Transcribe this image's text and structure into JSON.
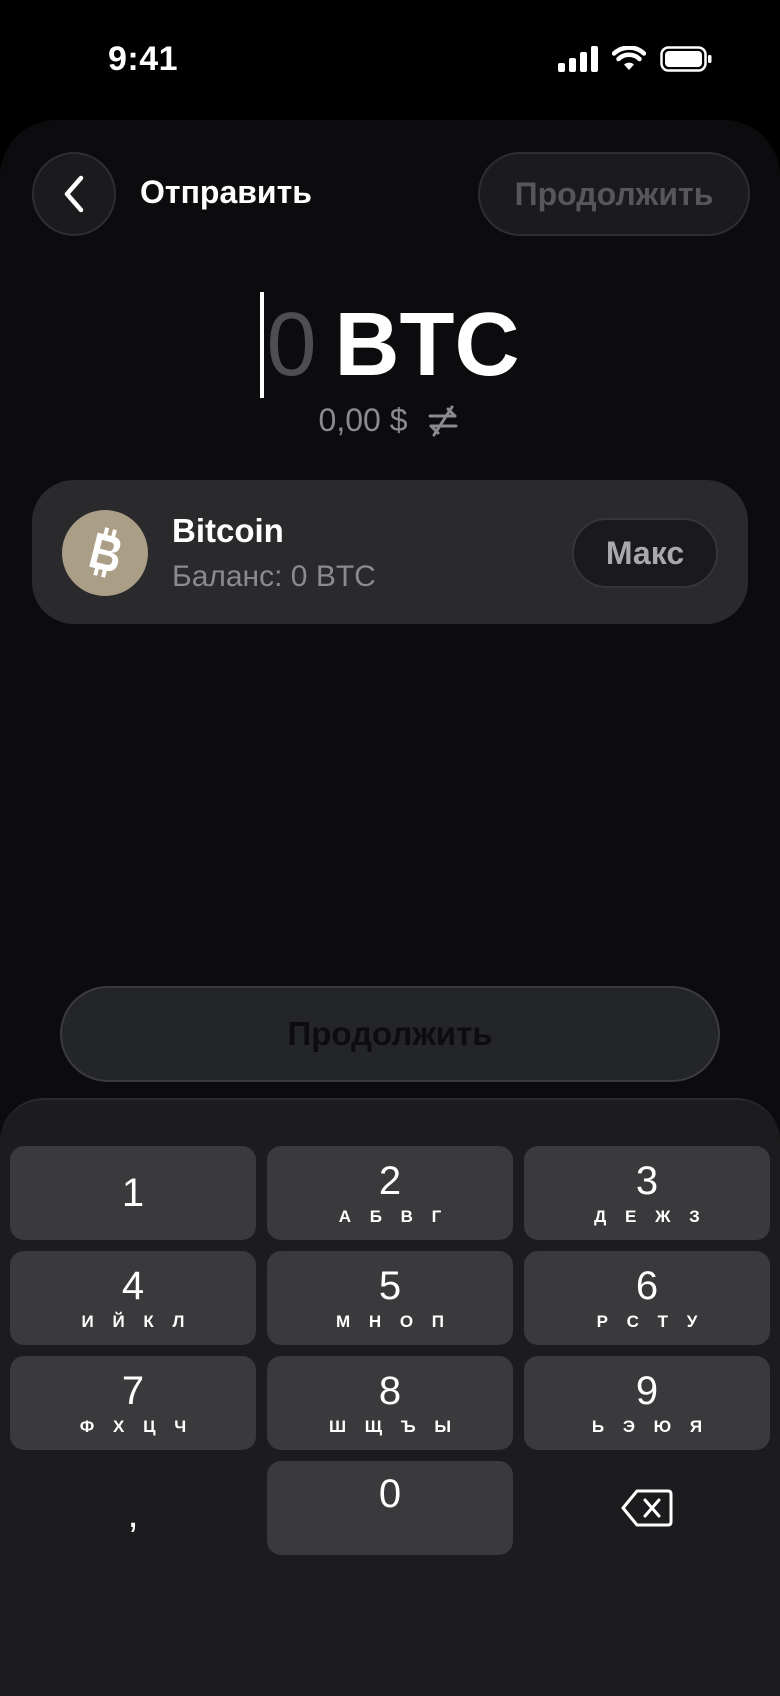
{
  "status_bar": {
    "time": "9:41"
  },
  "header": {
    "title": "Отправить",
    "continue_label": "Продолжить"
  },
  "amount": {
    "value": "0",
    "unit": "BTC",
    "fiat": "0,00 $"
  },
  "asset": {
    "name": "Bitcoin",
    "balance": "Баланс: 0 BTC",
    "max_label": "Макс"
  },
  "continue_button": {
    "label": "Продолжить"
  },
  "keypad": {
    "keys": [
      {
        "digit": "1",
        "letters": ""
      },
      {
        "digit": "2",
        "letters": "А Б В Г"
      },
      {
        "digit": "3",
        "letters": "Д Е Ж З"
      },
      {
        "digit": "4",
        "letters": "И Й К Л"
      },
      {
        "digit": "5",
        "letters": "М Н О П"
      },
      {
        "digit": "6",
        "letters": "Р С Т У"
      },
      {
        "digit": "7",
        "letters": "Ф Х Ц Ч"
      },
      {
        "digit": "8",
        "letters": "Ш Щ Ъ Ы"
      },
      {
        "digit": "9",
        "letters": "Ь Э Ю Я"
      },
      {
        "digit": "0",
        "letters": ""
      }
    ],
    "comma": ","
  },
  "colors": {
    "background": "#000000",
    "sheet": "#0c0c0e",
    "card": "#2a2a2d",
    "key": "#3a3a3c",
    "btc": "#ab9e87"
  }
}
